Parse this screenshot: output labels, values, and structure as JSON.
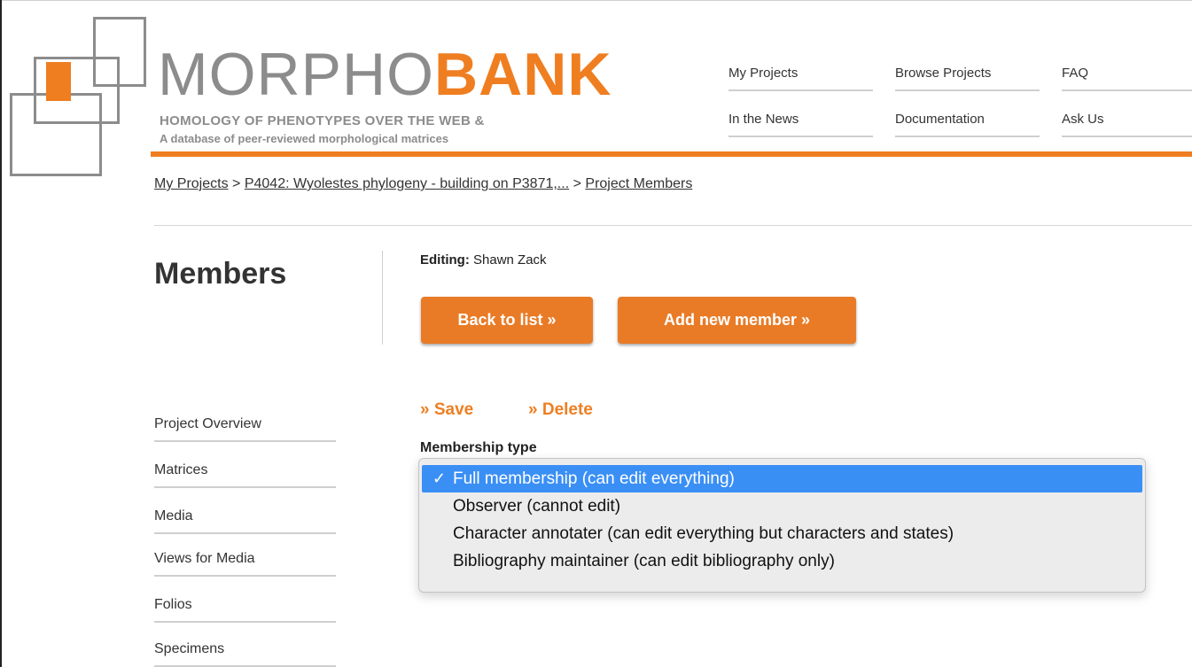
{
  "brand": {
    "name_part1": "MORPHO",
    "name_part2": "BANK",
    "tagline_line1": "HOMOLOGY OF PHENOTYPES OVER THE WEB &",
    "tagline_line2": "A database of peer-reviewed morphological matrices",
    "accent_color": "#ef7e21",
    "gray_color": "#8c8c8c"
  },
  "topnav": {
    "my_projects": "My Projects",
    "browse_projects": "Browse Projects",
    "faq": "FAQ",
    "in_the_news": "In the News",
    "documentation": "Documentation",
    "ask_us": "Ask Us"
  },
  "breadcrumb": {
    "crumb1": "My Projects",
    "sep": ">",
    "crumb2": "P4042: Wyolestes phylogeny - building on P3871,...",
    "crumb3": "Project Members"
  },
  "page": {
    "title": "Members",
    "editing_label": "Editing:",
    "editing_name": "Shawn Zack",
    "back_button": "Back to list »",
    "add_button": "Add new member »",
    "save_action": "» Save",
    "delete_action": "» Delete",
    "membership_label": "Membership type"
  },
  "dropdown": {
    "check_mark": "✓",
    "options": [
      "Full membership (can edit everything)",
      "Observer (cannot edit)",
      "Character annotater (can edit everything but characters and states)",
      "Bibliography maintainer (can edit bibliography only)"
    ],
    "selected_index": 0,
    "selected_color": "#3a8ff5"
  },
  "sidenav": {
    "items": [
      "Project Overview",
      "Matrices",
      "Media",
      "Views for Media",
      "Folios",
      "Specimens"
    ]
  }
}
